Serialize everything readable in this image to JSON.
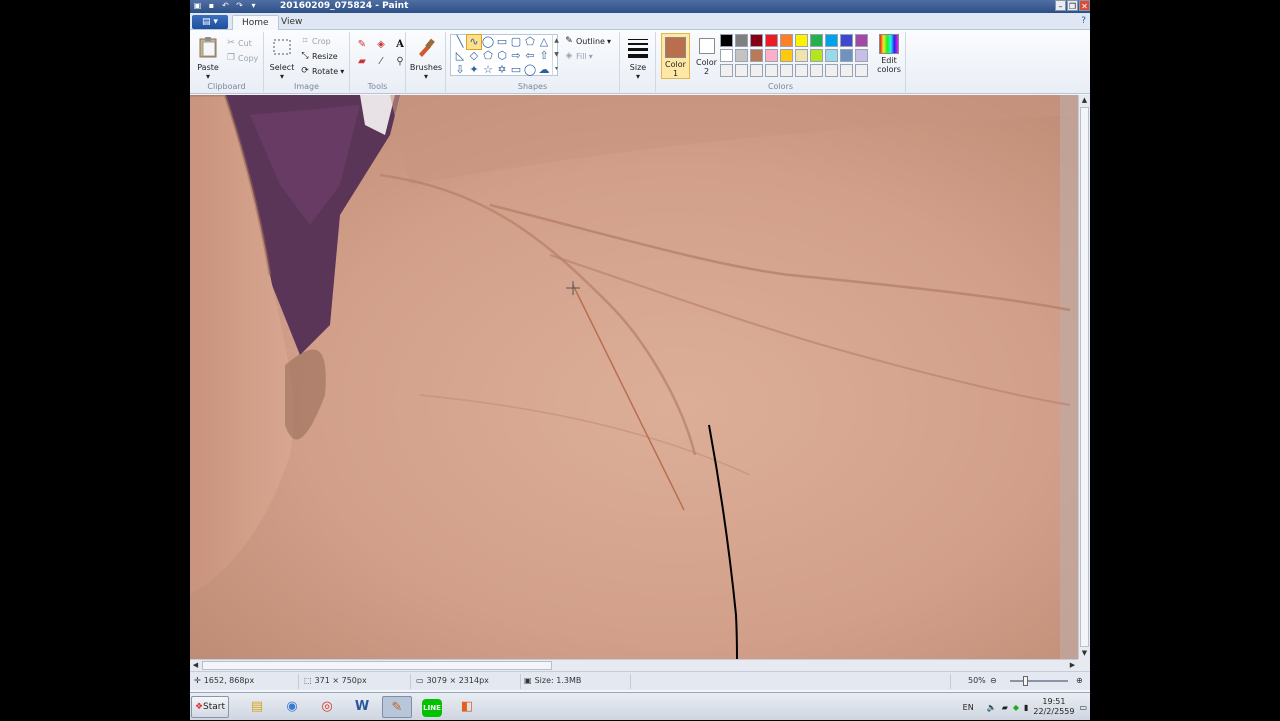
{
  "window": {
    "title": "20160209_075824 - Paint"
  },
  "tabs": {
    "file_label": "▤ ▾",
    "home": "Home",
    "view": "View"
  },
  "ribbon": {
    "clipboard": {
      "label": "Clipboard",
      "paste": "Paste",
      "cut": "Cut",
      "copy": "Copy"
    },
    "image": {
      "label": "Image",
      "select": "Select",
      "crop": "Crop",
      "resize": "Resize",
      "rotate": "Rotate"
    },
    "tools": {
      "label": "Tools"
    },
    "brushes": {
      "label": "Brushes"
    },
    "shapes": {
      "label": "Shapes",
      "outline": "Outline",
      "fill": "Fill"
    },
    "size": {
      "label": "Size"
    },
    "colors": {
      "label": "Colors",
      "color1": "Color 1",
      "color2": "Color 2",
      "edit": "Edit colors",
      "color1_value": "#b96f4d",
      "color2_value": "#ffffff",
      "palette": [
        "#000000",
        "#7f7f7f",
        "#880015",
        "#ed1c24",
        "#ff7f27",
        "#fff200",
        "#22b14c",
        "#00a2e8",
        "#3f48cc",
        "#a349a4",
        "#ffffff",
        "#c3c3c3",
        "#b97a57",
        "#ffaec9",
        "#ffc90e",
        "#efe4b0",
        "#b5e61d",
        "#99d9ea",
        "#7092be",
        "#c8bfe7",
        "#f0f0f0",
        "#f0f0f0",
        "#f0f0f0",
        "#f0f0f0",
        "#f0f0f0",
        "#f0f0f0",
        "#f0f0f0",
        "#f0f0f0",
        "#f0f0f0",
        "#f0f0f0"
      ]
    }
  },
  "status": {
    "cursor_pos": "1652, 868px",
    "selection_size": "371 × 750px",
    "image_size": "3079 × 2314px",
    "file_size": "Size: 1.3MB",
    "zoom": "50%",
    "zoom_fraction": 0.5
  },
  "taskbar": {
    "start": "Start",
    "lang": "EN",
    "time": "19:51",
    "date": "22/2/2559"
  }
}
